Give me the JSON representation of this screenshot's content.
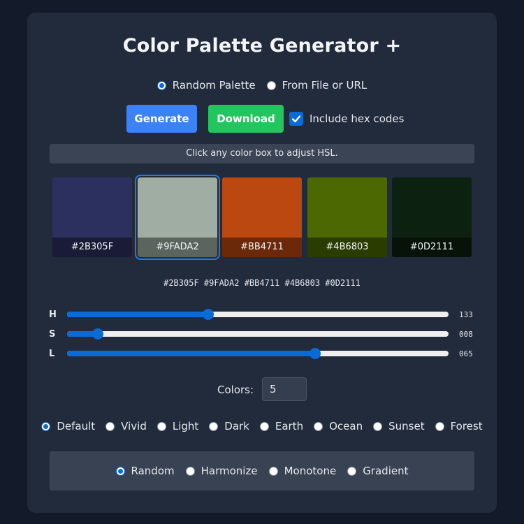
{
  "app": {
    "title": "Color Palette Generator +"
  },
  "source": {
    "options": [
      {
        "label": "Random Palette",
        "selected": true
      },
      {
        "label": "From File or URL",
        "selected": false
      }
    ]
  },
  "toolbar": {
    "generate_label": "Generate",
    "download_label": "Download",
    "include_hex_label": "Include hex codes",
    "include_hex_checked": true,
    "generate_color": "#3b82f6",
    "download_color": "#22c55e"
  },
  "hint": "Click any color box to adjust HSL.",
  "palette": {
    "swatches": [
      {
        "hex": "#2B305F",
        "selected": false
      },
      {
        "hex": "#9FADA2",
        "selected": true
      },
      {
        "hex": "#BB4711",
        "selected": false
      },
      {
        "hex": "#4B6803",
        "selected": false
      },
      {
        "hex": "#0D2111",
        "selected": false
      }
    ],
    "hex_list": "#2B305F #9FADA2 #BB4711 #4B6803 #0D2111"
  },
  "hsl": {
    "h": {
      "label": "H",
      "display": "133",
      "value": 133,
      "max": 360
    },
    "s": {
      "label": "S",
      "display": "008",
      "value": 8,
      "max": 100
    },
    "l": {
      "label": "L",
      "display": "065",
      "value": 65,
      "max": 100
    }
  },
  "count": {
    "label": "Colors:",
    "value": "5"
  },
  "themes": [
    {
      "label": "Default",
      "selected": true
    },
    {
      "label": "Vivid",
      "selected": false
    },
    {
      "label": "Light",
      "selected": false
    },
    {
      "label": "Dark",
      "selected": false
    },
    {
      "label": "Earth",
      "selected": false
    },
    {
      "label": "Ocean",
      "selected": false
    },
    {
      "label": "Sunset",
      "selected": false
    },
    {
      "label": "Forest",
      "selected": false
    }
  ],
  "modes": [
    {
      "label": "Random",
      "selected": true
    },
    {
      "label": "Harmonize",
      "selected": false
    },
    {
      "label": "Monotone",
      "selected": false
    },
    {
      "label": "Gradient",
      "selected": false
    }
  ],
  "colors": {
    "accent": "#0a6bd6",
    "background": "#131a2a",
    "card": "#222b3b"
  }
}
